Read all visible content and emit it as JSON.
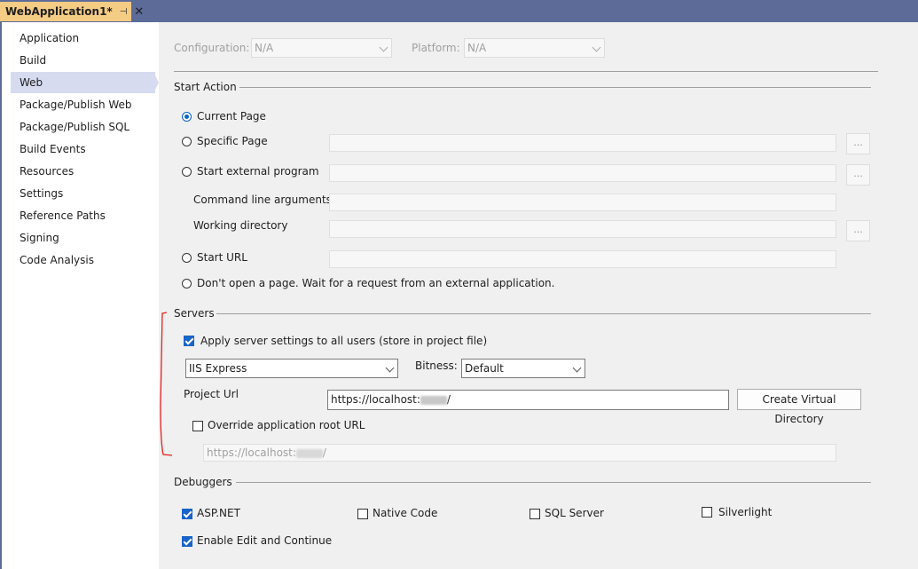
{
  "document_tab": {
    "title": "WebApplication1*",
    "pin_glyph": "⊣",
    "close_glyph": "✕"
  },
  "sidebar": {
    "items": [
      {
        "label": "Application"
      },
      {
        "label": "Build"
      },
      {
        "label": "Web",
        "selected": true
      },
      {
        "label": "Package/Publish Web"
      },
      {
        "label": "Package/Publish SQL"
      },
      {
        "label": "Build Events"
      },
      {
        "label": "Resources"
      },
      {
        "label": "Settings"
      },
      {
        "label": "Reference Paths"
      },
      {
        "label": "Signing"
      },
      {
        "label": "Code Analysis"
      }
    ]
  },
  "config": {
    "configuration_label": "Configuration:",
    "configuration_value": "N/A",
    "platform_label": "Platform:",
    "platform_value": "N/A"
  },
  "start_action": {
    "heading": "Start Action",
    "current_page": "Current Page",
    "specific_page": "Specific Page",
    "start_external_program": "Start external program",
    "command_line_arguments": "Command line arguments",
    "working_directory": "Working directory",
    "start_url": "Start URL",
    "dont_open": "Don't open a page.  Wait for a request from an external application.",
    "browse_glyph": "..."
  },
  "servers": {
    "heading": "Servers",
    "apply_settings": "Apply server settings to all users (store in project file)",
    "server_value": "IIS Express",
    "bitness_label": "Bitness:",
    "bitness_value": "Default",
    "project_url_label": "Project Url",
    "project_url_prefix": "https://localhost:",
    "project_url_suffix": "/",
    "create_virtual_directory": "Create Virtual Directory",
    "override_root_url": "Override application root URL",
    "override_url_prefix": "https://localhost:",
    "override_url_suffix": "/"
  },
  "debuggers": {
    "heading": "Debuggers",
    "aspnet": "ASP.NET",
    "native_code": "Native Code",
    "sql_server": "SQL Server",
    "silverlight": "Silverlight",
    "edit_continue": "Enable Edit and Continue"
  },
  "colors": {
    "titlebar": "#5d6b99",
    "tab_active": "#f5cc84",
    "accent": "#1a64c8",
    "annotation": "#e02020"
  }
}
